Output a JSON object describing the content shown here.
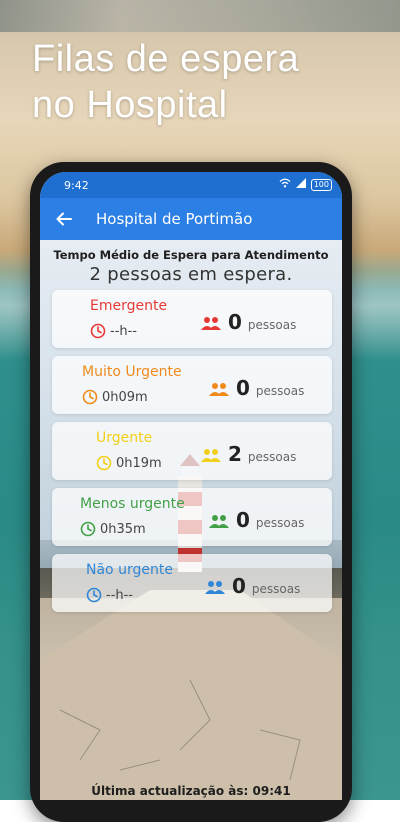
{
  "promo": {
    "line1": "Filas de espera",
    "line2": "no Hospital"
  },
  "statusbar": {
    "time": "9:42",
    "battery": "100"
  },
  "appbar": {
    "title": "Hospital de Portimão"
  },
  "summary": {
    "subtitle": "Tempo Médio de Espera para Atendimento",
    "total": "2 pessoas em espera."
  },
  "people_unit": "pessoas",
  "levels": [
    {
      "name": "Emergente",
      "wait": "--h--",
      "count": "0",
      "color": "#e53935"
    },
    {
      "name": "Muito Urgente",
      "wait": "0h09m",
      "count": "0",
      "color": "#f08a1c"
    },
    {
      "name": "Urgente",
      "wait": "0h19m",
      "count": "2",
      "color": "#f2cf1a"
    },
    {
      "name": "Menos urgente",
      "wait": "0h35m",
      "count": "0",
      "color": "#43a047"
    },
    {
      "name": "Não urgente",
      "wait": "--h--",
      "count": "0",
      "color": "#2f86d6"
    }
  ],
  "footer": {
    "last_update": "Última actualização às: 09:41"
  },
  "icons": {
    "back": "arrow-back-icon",
    "clock": "clock-icon",
    "people": "people-icon"
  }
}
